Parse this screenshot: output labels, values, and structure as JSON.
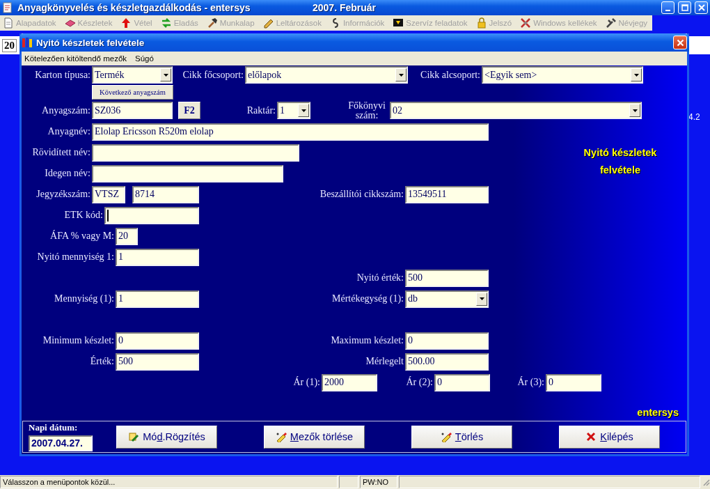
{
  "window": {
    "title": "Anyagkönyvelés és készletgazdálkodás - entersys",
    "period": "2007. Február"
  },
  "menu": [
    {
      "label": "Alapadatok",
      "disabled": true
    },
    {
      "label": "Készletek",
      "disabled": true
    },
    {
      "label": "Vétel",
      "disabled": true
    },
    {
      "label": "Eladás",
      "disabled": true
    },
    {
      "label": "Munkalap",
      "disabled": true
    },
    {
      "label": "Leltározások",
      "disabled": true
    },
    {
      "label": "Információk",
      "disabled": true
    },
    {
      "label": "Szervíz feladatok",
      "disabled": true
    },
    {
      "label": "Jelszó",
      "disabled": true
    },
    {
      "label": "Windows kellékek",
      "disabled": true
    },
    {
      "label": "Névjegy",
      "disabled": true
    }
  ],
  "background": {
    "toolbar_text": "20",
    "side_text": "4.2"
  },
  "dialog": {
    "title": "Nyitó készletek felvétele",
    "menu": [
      "Kötelezően kitöltendő mezők",
      "Súgó"
    ],
    "heading": "Nyitó készletek felvétele",
    "brand": "entersys",
    "next_number_button": "Következő anyagszám",
    "f2_button": "F2",
    "form": {
      "karton_tipusa": {
        "label": "Karton típusa:",
        "kind": "select",
        "value": "Termék"
      },
      "cikk_focsoport": {
        "label": "Cikk főcsoport:",
        "kind": "select",
        "value": "előlapok"
      },
      "cikk_alcsoport": {
        "label": "Cikk alcsoport:",
        "kind": "select",
        "value": "<Egyik sem>"
      },
      "anyagszam": {
        "label": "Anyagszám:",
        "kind": "input",
        "value": "SZ036",
        "focused": false
      },
      "raktar": {
        "label": "Raktár:",
        "kind": "select",
        "value": "1"
      },
      "fokonyvi_szam": {
        "label": "Főkönyvi szám:",
        "kind": "select",
        "value": "02"
      },
      "anyagnev": {
        "label": "Anyagnév:",
        "kind": "input",
        "value": "Elolap Ericsson R520m elolap",
        "focused": false
      },
      "roviditett_nev": {
        "label": "Rövidített név:",
        "kind": "input",
        "focused": false
      },
      "idegen_nev": {
        "label": "Idegen név:",
        "kind": "input",
        "focused": false
      },
      "jegyzekszam": {
        "label": "Jegyzékszám:",
        "kind": "input",
        "value": "VTSZ",
        "focused": false
      },
      "jegyzekszam_2": {
        "kind": "input",
        "value": "8714",
        "focused": false
      },
      "beszallitoi_cikkszam": {
        "label": "Beszállítói cikkszám:",
        "kind": "input",
        "value": "13549511",
        "focused": false
      },
      "etk_kod": {
        "label": "ETK kód:",
        "kind": "input",
        "focused": true
      },
      "afa": {
        "label": "ÁFA % vagy M:",
        "kind": "input",
        "value": "20",
        "focused": false
      },
      "nyito_mennyiseg": {
        "label": "Nyitó mennyiség 1:",
        "kind": "input",
        "value": "1",
        "focused": false
      },
      "nyito_ertek": {
        "label": "Nyitó érték:",
        "kind": "input",
        "value": "500",
        "focused": false
      },
      "mennyiseg": {
        "label": "Mennyiség (1):",
        "kind": "input",
        "value": "1",
        "focused": false
      },
      "mertekegyseg": {
        "label": "Mértékegység (1):",
        "kind": "select",
        "value": "db"
      },
      "minimum_keszlet": {
        "label": "Minimum készlet:",
        "kind": "input",
        "value": "0",
        "focused": false
      },
      "maximum_keszlet": {
        "label": "Maximum készlet:",
        "kind": "input",
        "value": "0",
        "focused": false
      },
      "ertek": {
        "label": "Érték:",
        "kind": "input",
        "value": "500",
        "focused": false
      },
      "merlegelt": {
        "label": "Mérlegelt",
        "kind": "input",
        "value": "500.00",
        "focused": false
      },
      "ar_1": {
        "label": "Ár (1):",
        "kind": "input",
        "value": "2000",
        "focused": false
      },
      "ar_2": {
        "label": "Ár (2):",
        "kind": "input",
        "value": "0",
        "focused": false
      },
      "ar_3": {
        "label": "Ár (3):",
        "kind": "input",
        "value": "0",
        "focused": false
      }
    },
    "footer": {
      "date_label": "Napi dátum:",
      "date": "2007.04.27.",
      "buttons": [
        {
          "before": "Mó",
          "accel": "d",
          "after": ".Rögzítés"
        },
        {
          "accel": "M",
          "after": "ezők törlése"
        },
        {
          "accel": "T",
          "after": "örlés"
        },
        {
          "accel": "K",
          "after": "ilépés"
        }
      ]
    }
  },
  "status_bar": {
    "message": "Válasszon a menüpontok közül...",
    "password": "PW:NO"
  }
}
